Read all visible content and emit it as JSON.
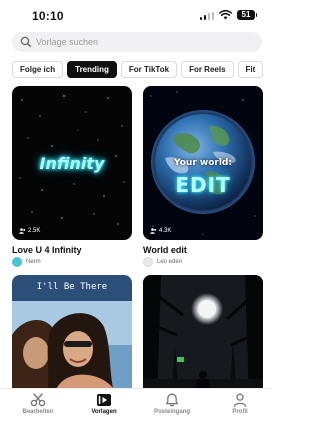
{
  "status": {
    "time": "10:10",
    "battery": "51"
  },
  "search": {
    "placeholder": "Vorlage suchen"
  },
  "filters": [
    "Folge ich",
    "Trending",
    "For TikTok",
    "For Reels",
    "Fit"
  ],
  "active_filter": "Trending",
  "cards": [
    {
      "title": "Love U 4 Infinity",
      "author": "Nerm",
      "uses": "2.5K",
      "art_text": "Infinity"
    },
    {
      "title": "World edit",
      "author": "Leo eden",
      "uses": "4.3K",
      "art_text_top": "Your world:",
      "art_text_main": "EDIT"
    },
    {
      "art_text": "I'll Be There"
    },
    {}
  ],
  "nav": [
    {
      "label": "Bearbeiten",
      "icon": "scissors-icon"
    },
    {
      "label": "Vorlagen",
      "icon": "templates-icon",
      "active": true
    },
    {
      "label": "Posteingang",
      "icon": "bell-icon"
    },
    {
      "label": "Profil",
      "icon": "person-icon"
    }
  ],
  "colors": {
    "accent": "#111111",
    "neon": "#5ef2ff",
    "neon_edit": "#3ff0ff"
  }
}
